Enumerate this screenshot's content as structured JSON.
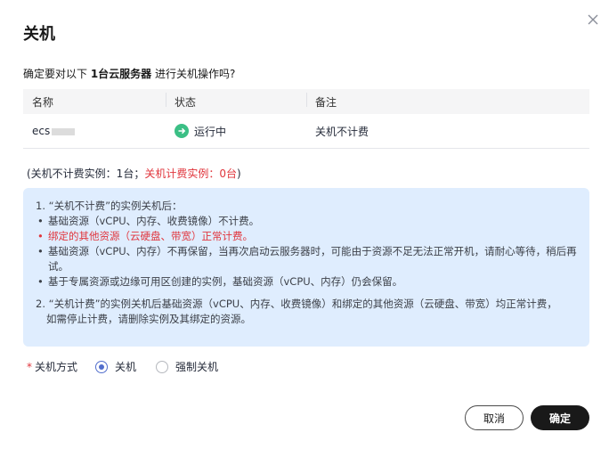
{
  "dialog": {
    "title": "关机",
    "close_icon": "close-icon",
    "confirm_prefix": "确定要对以下 ",
    "confirm_bold": "1台云服务器",
    "confirm_suffix": " 进行关机操作吗?"
  },
  "table": {
    "columns": [
      "名称",
      "状态",
      "备注"
    ],
    "rows": [
      {
        "name": "ecs",
        "status_icon": "running-arrow-icon",
        "status": "运行中",
        "note": "关机不计费"
      }
    ]
  },
  "counts": {
    "nonbilled": "(关机不计费实例：1台；",
    "billed": "关机计费实例：0台",
    "close_paren": ")"
  },
  "notice": {
    "sec1_title": "1. “关机不计费”的实例关机后：",
    "sec1_items": [
      "基础资源（vCPU、内存、收费镜像）不计费。",
      "绑定的其他资源（云硬盘、带宽）正常计费。",
      "基础资源（vCPU、内存）不再保留，当再次启动云服务器时，可能由于资源不足无法正常开机，请耐心等待，稍后再试。",
      "基于专属资源或边缘可用区创建的实例，基础资源（vCPU、内存）仍会保留。"
    ],
    "sec2_line1": "2. “关机计费”的实例关机后基础资源（vCPU、内存、收费镜像）和绑定的其他资源（云硬盘、带宽）均正常计费，",
    "sec2_line2": "如需停止计费，请删除实例及其绑定的资源。"
  },
  "method": {
    "required_mark": "*",
    "label": "关机方式",
    "options": [
      "关机",
      "强制关机"
    ],
    "selected": "关机"
  },
  "buttons": {
    "cancel": "取消",
    "ok": "确定"
  },
  "colors": {
    "accent": "#526ecc",
    "danger": "#e0353c",
    "notice_bg": "#dfedfe",
    "status_green": "#3bbf85"
  }
}
